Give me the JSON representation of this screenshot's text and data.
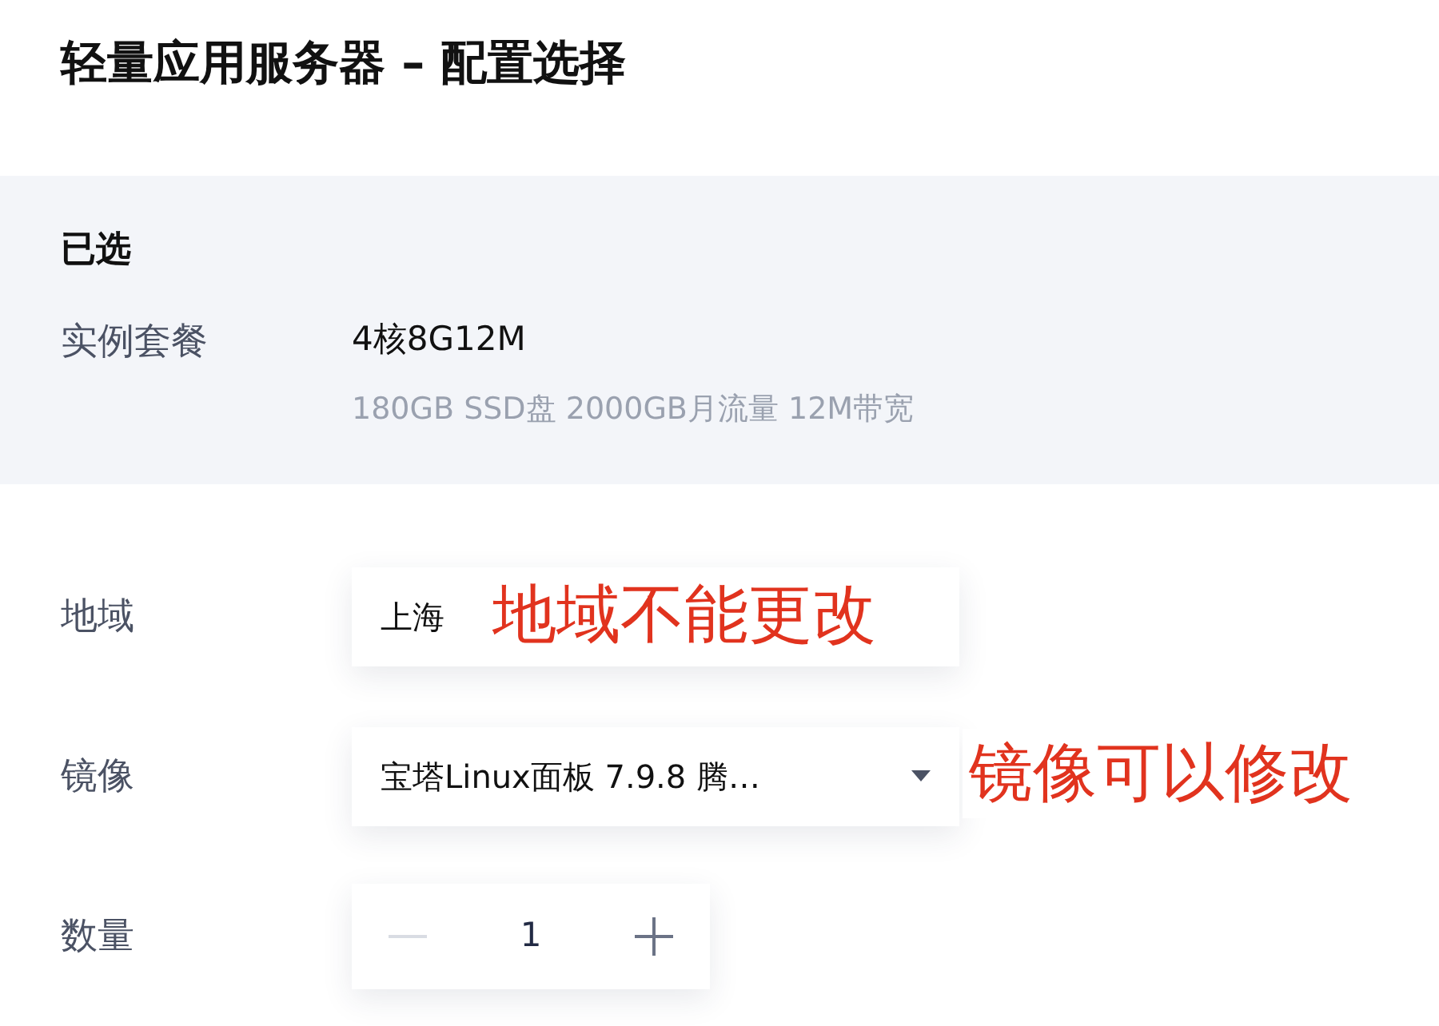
{
  "title": "轻量应用服务器 – 配置选择",
  "selected": {
    "heading": "已选",
    "label": "实例套餐",
    "plan": "4核8G12M",
    "specs": "180GB SSD盘 2000GB月流量 12M带宽"
  },
  "fields": [
    {
      "kind": "select",
      "label": "地域",
      "value": "上海",
      "annotation": "地域不能更改"
    },
    {
      "kind": "select",
      "label": "镜像",
      "value": "宝塔Linux面板 7.9.8 腾…",
      "annotation": "镜像可以修改"
    },
    {
      "kind": "stepper",
      "label": "数量",
      "value": "1",
      "minus_disabled": true,
      "plus_disabled": false
    }
  ]
}
